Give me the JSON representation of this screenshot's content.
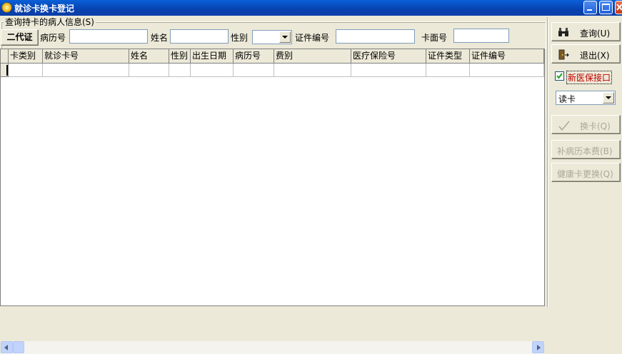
{
  "window": {
    "title": "就诊卡换卡登记"
  },
  "query_group": {
    "legend": "查询持卡的病人信息(S)",
    "id_card_button": "二代证",
    "record_no_label": "病历号",
    "record_no_value": "",
    "name_label": "姓名",
    "name_value": "",
    "gender_label": "性别",
    "gender_value": "",
    "cert_no_label": "证件编号",
    "cert_no_value": "",
    "card_face_label": "卡面号",
    "card_face_value": ""
  },
  "table": {
    "columns": [
      "卡类别",
      "就诊卡号",
      "姓名",
      "性别",
      "出生日期",
      "病历号",
      "费别",
      "医疗保险号",
      "证件类型",
      "证件编号"
    ],
    "rows": [
      [
        "",
        "",
        "",
        "",
        "",
        "",
        "",
        "",
        "",
        ""
      ]
    ]
  },
  "side": {
    "query_button": "查询(U)",
    "exit_button": "退出(X)",
    "new_insurance_checkbox": "新医保接口",
    "new_insurance_checked": true,
    "read_mode": "读卡",
    "swap_card_button": "换卡(Q)",
    "reissue_book_button": "补病历本费(B)",
    "health_card_button": "健康卡更换(Q)"
  },
  "colors": {
    "title_bar": "#0842b0",
    "accent_red": "#c00000",
    "window_bg": "#ece9d8"
  }
}
